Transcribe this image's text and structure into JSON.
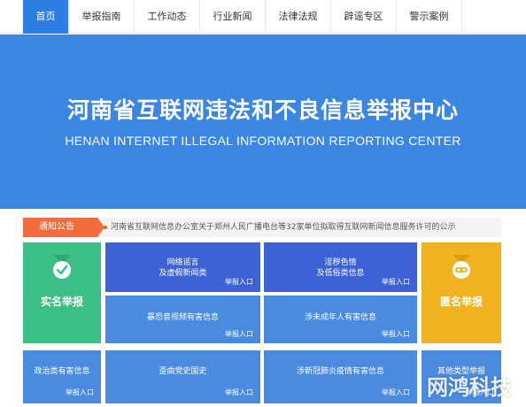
{
  "nav": {
    "items": [
      {
        "label": "首页",
        "active": true
      },
      {
        "label": "举报指南",
        "active": false
      },
      {
        "label": "工作动态",
        "active": false
      },
      {
        "label": "行业新闻",
        "active": false
      },
      {
        "label": "法律法规",
        "active": false
      },
      {
        "label": "辟谣专区",
        "active": false
      },
      {
        "label": "警示案例",
        "active": false
      }
    ]
  },
  "banner": {
    "title": "河南省互联网违法和不良信息举报中心",
    "subtitle": "HENAN INTERNET ILLEGAL INFORMATION REPORTING CENTER"
  },
  "notice": {
    "label": "通知公告",
    "text": "河南省互联网信息办公室关于郑州人民广播电台等32家单位拟取得互联网新闻信息服务许可的公示"
  },
  "tiles": {
    "real_name": {
      "label": "实名举报",
      "icon": "user-check-icon",
      "color": "#3bbf86"
    },
    "anonymous": {
      "label": "匿名举报",
      "icon": "mask-icon",
      "color": "#f0b21e"
    },
    "rumor": {
      "line1": "网络谣言",
      "line2": "及虚假新闻类",
      "enter": "举报入口"
    },
    "porn": {
      "line1": "淫秽色情",
      "line2": "及低俗类信息",
      "enter": "举报入口"
    },
    "violence": {
      "title": "暴恐音视频有害信息",
      "enter": "举报入口"
    },
    "minor": {
      "title": "涉未成年人有害信息",
      "enter": "举报入口"
    },
    "politics": {
      "title": "政治类有害信息",
      "enter": "举报入口"
    },
    "history": {
      "title": "歪曲党史国史",
      "enter": "举报入口"
    },
    "covid": {
      "title": "涉新冠肺炎疫情有害信息",
      "enter": "举报入口"
    },
    "other": {
      "title": "其他类型举报",
      "enter": "举报入口"
    }
  },
  "colors": {
    "nav_active": "#2d7ee3",
    "banner": "#3a86e2",
    "tile_dark": "#3c62d6",
    "tile_light": "#4a8be0",
    "notice_label": "#f26b3a"
  },
  "watermark": "网鸿科技"
}
